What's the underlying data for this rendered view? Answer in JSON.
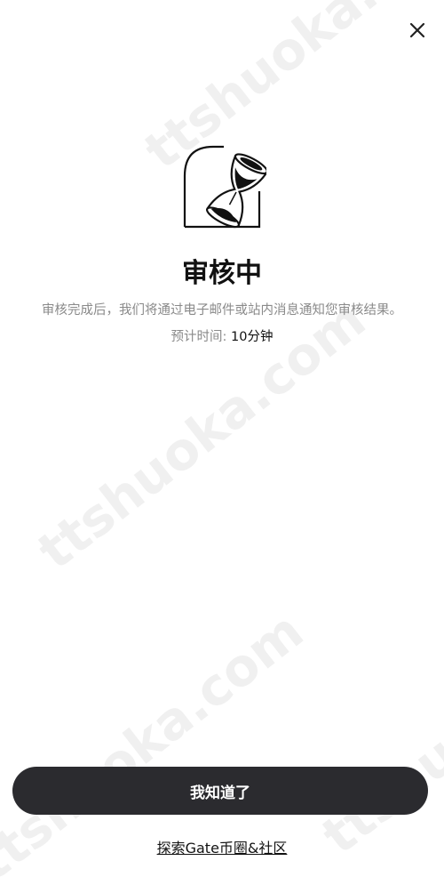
{
  "header": {
    "close_icon": "close-icon"
  },
  "status": {
    "icon": "hourglass-icon",
    "title": "审核中",
    "description": "审核完成后，我们将通过电子邮件或站内消息通知您审核结果。",
    "eta_label": "预计时间: ",
    "eta_value": "10分钟"
  },
  "actions": {
    "primary_label": "我知道了",
    "explore_label": "探索Gate币圈&社区",
    "primary_bg": "#2b2b2f"
  },
  "watermarks": {
    "w1": "ttshuoka.com",
    "w2": "ttshuoka.com",
    "w3": "ttshuoka.com",
    "w4": "ttshuoka.com"
  }
}
